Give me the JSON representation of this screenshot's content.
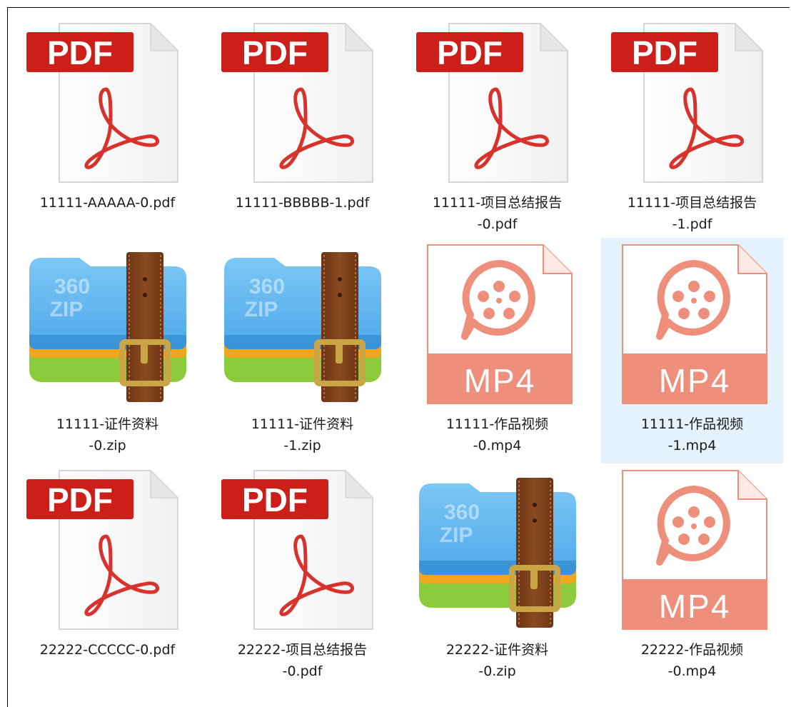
{
  "window": {
    "view": "large-icons"
  },
  "files": [
    {
      "type": "pdf",
      "name": "11111-AAAAA-0.pdf",
      "selected": false
    },
    {
      "type": "pdf",
      "name": "11111-BBBBB-1.pdf",
      "selected": false
    },
    {
      "type": "pdf",
      "name": "11111-项目总结报告\n-0.pdf",
      "selected": false
    },
    {
      "type": "pdf",
      "name": "11111-项目总结报告\n-1.pdf",
      "selected": false
    },
    {
      "type": "zip",
      "name": "11111-证件资料\n-0.zip",
      "selected": false
    },
    {
      "type": "zip",
      "name": "11111-证件资料\n-1.zip",
      "selected": false
    },
    {
      "type": "mp4",
      "name": "11111-作品视频\n-0.mp4",
      "selected": false
    },
    {
      "type": "mp4",
      "name": "11111-作品视频\n-1.mp4",
      "selected": true
    },
    {
      "type": "pdf",
      "name": "22222-CCCCC-0.pdf",
      "selected": false
    },
    {
      "type": "pdf",
      "name": "22222-项目总结报告\n-0.pdf",
      "selected": false
    },
    {
      "type": "zip",
      "name": "22222-证件资料\n-0.zip",
      "selected": false
    },
    {
      "type": "mp4",
      "name": "22222-作品视频\n-0.mp4",
      "selected": false
    }
  ],
  "icons": {
    "pdf": {
      "name": "pdf-file-icon",
      "badge_text": "PDF",
      "badge_color": "#cc1f1a",
      "acrobat_color": "#d8322c"
    },
    "zip": {
      "name": "360zip-archive-icon",
      "badge_text": "360\nZIP",
      "top_color": "#4fa8ea",
      "mid_color": "#f5a41e",
      "bottom_color": "#8ccc3c",
      "strap_color": "#8a4a20",
      "buckle_color": "#c9a545"
    },
    "mp4": {
      "name": "mp4-video-file-icon",
      "badge_text": "MP4",
      "accent_color": "#ee8f7b"
    }
  },
  "selection_color": "#e5f1fb"
}
